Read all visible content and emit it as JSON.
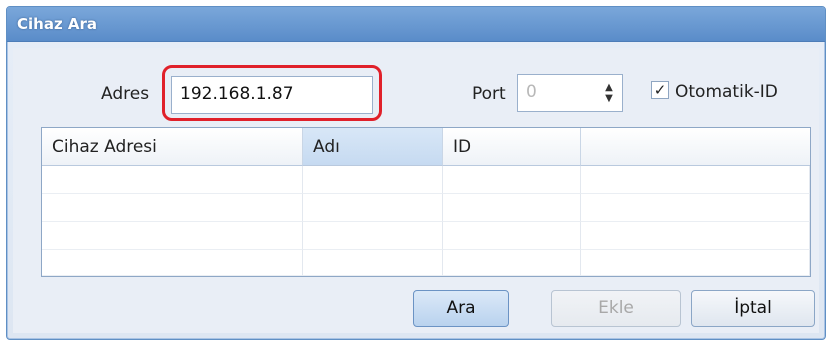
{
  "window": {
    "title": "Cihaz Ara"
  },
  "form": {
    "address_label": "Adres",
    "address_value": "192.168.1.87",
    "port_label": "Port",
    "port_value": "0",
    "auto_id_label": "Otomatik-ID",
    "auto_id_checked": true
  },
  "table": {
    "columns": [
      "Cihaz Adresi",
      "Adı",
      "ID",
      ""
    ],
    "rows": []
  },
  "buttons": {
    "search": "Ara",
    "add": "Ekle",
    "cancel": "İptal"
  },
  "icons": {
    "check": "check-mark-icon",
    "spin_up": "spin-up-icon",
    "spin_down": "spin-down-icon"
  },
  "colors": {
    "title_bar": "#5a8cc9",
    "highlight": "#e0202a"
  }
}
